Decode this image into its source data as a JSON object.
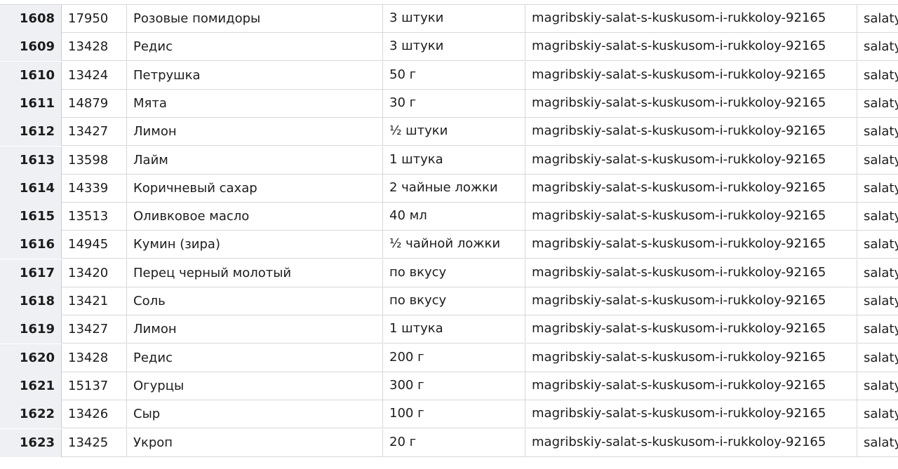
{
  "table": {
    "rows": [
      {
        "index": "1608",
        "id": "17950",
        "name": "Розовые помидоры",
        "qty": "3 штуки",
        "slug": "magribskiy-salat-s-kuskusom-i-rukkoloy-92165",
        "category": "salaty"
      },
      {
        "index": "1609",
        "id": "13428",
        "name": "Редис",
        "qty": "3 штуки",
        "slug": "magribskiy-salat-s-kuskusom-i-rukkoloy-92165",
        "category": "salaty"
      },
      {
        "index": "1610",
        "id": "13424",
        "name": "Петрушка",
        "qty": "50 г",
        "slug": "magribskiy-salat-s-kuskusom-i-rukkoloy-92165",
        "category": "salaty"
      },
      {
        "index": "1611",
        "id": "14879",
        "name": "Мята",
        "qty": "30 г",
        "slug": "magribskiy-salat-s-kuskusom-i-rukkoloy-92165",
        "category": "salaty"
      },
      {
        "index": "1612",
        "id": "13427",
        "name": "Лимон",
        "qty": "½ штуки",
        "slug": "magribskiy-salat-s-kuskusom-i-rukkoloy-92165",
        "category": "salaty"
      },
      {
        "index": "1613",
        "id": "13598",
        "name": "Лайм",
        "qty": "1 штука",
        "slug": "magribskiy-salat-s-kuskusom-i-rukkoloy-92165",
        "category": "salaty"
      },
      {
        "index": "1614",
        "id": "14339",
        "name": "Коричневый сахар",
        "qty": "2 чайные ложки",
        "slug": "magribskiy-salat-s-kuskusom-i-rukkoloy-92165",
        "category": "salaty"
      },
      {
        "index": "1615",
        "id": "13513",
        "name": "Оливковое масло",
        "qty": "40 мл",
        "slug": "magribskiy-salat-s-kuskusom-i-rukkoloy-92165",
        "category": "salaty"
      },
      {
        "index": "1616",
        "id": "14945",
        "name": "Кумин (зира)",
        "qty": "½ чайной ложки",
        "slug": "magribskiy-salat-s-kuskusom-i-rukkoloy-92165",
        "category": "salaty"
      },
      {
        "index": "1617",
        "id": "13420",
        "name": "Перец черный молотый",
        "qty": "по вкусу",
        "slug": "magribskiy-salat-s-kuskusom-i-rukkoloy-92165",
        "category": "salaty"
      },
      {
        "index": "1618",
        "id": "13421",
        "name": "Соль",
        "qty": "по вкусу",
        "slug": "magribskiy-salat-s-kuskusom-i-rukkoloy-92165",
        "category": "salaty"
      },
      {
        "index": "1619",
        "id": "13427",
        "name": "Лимон",
        "qty": "1 штука",
        "slug": "magribskiy-salat-s-kuskusom-i-rukkoloy-92165",
        "category": "salaty"
      },
      {
        "index": "1620",
        "id": "13428",
        "name": "Редис",
        "qty": "200 г",
        "slug": "magribskiy-salat-s-kuskusom-i-rukkoloy-92165",
        "category": "salaty"
      },
      {
        "index": "1621",
        "id": "15137",
        "name": "Огурцы",
        "qty": "300 г",
        "slug": "magribskiy-salat-s-kuskusom-i-rukkoloy-92165",
        "category": "salaty"
      },
      {
        "index": "1622",
        "id": "13426",
        "name": "Сыр",
        "qty": "100 г",
        "slug": "magribskiy-salat-s-kuskusom-i-rukkoloy-92165",
        "category": "salaty"
      },
      {
        "index": "1623",
        "id": "13425",
        "name": "Укроп",
        "qty": "20 г",
        "slug": "magribskiy-salat-s-kuskusom-i-rukkoloy-92165",
        "category": "salaty"
      }
    ]
  }
}
